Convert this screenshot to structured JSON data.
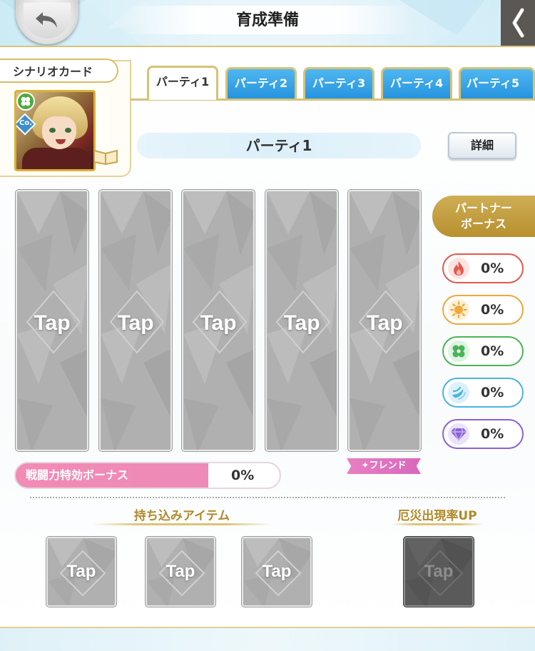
{
  "header": {
    "title": "育成準備"
  },
  "scenario": {
    "label": "シナリオカード",
    "card_attribute": "Co."
  },
  "tabs": [
    {
      "label": "パーティ1",
      "active": true
    },
    {
      "label": "パーティ2",
      "active": false
    },
    {
      "label": "パーティ3",
      "active": false
    },
    {
      "label": "パーティ4",
      "active": false
    },
    {
      "label": "パーティ5",
      "active": false
    }
  ],
  "party": {
    "name": "パーティ1",
    "detail_button": "詳細"
  },
  "slots": {
    "tap_label": "Tap",
    "friend_tag": "✦フレンド"
  },
  "partner": {
    "title_line1": "パートナー",
    "title_line2": "ボーナス",
    "bonuses": [
      {
        "icon": "fire-icon",
        "value": "0%",
        "color": "#e05a4f"
      },
      {
        "icon": "sun-icon",
        "value": "0%",
        "color": "#f0a83a"
      },
      {
        "icon": "clover-icon",
        "value": "0%",
        "color": "#4bb35a"
      },
      {
        "icon": "wind-icon",
        "value": "0%",
        "color": "#4bb3e0"
      },
      {
        "icon": "diamond-icon",
        "value": "0%",
        "color": "#8a62d8"
      }
    ]
  },
  "combat": {
    "label": "戦闘力特効ボーナス",
    "value": "0%"
  },
  "items": {
    "title": "持ち込みアイテム",
    "tap_label": "Tap"
  },
  "calamity": {
    "title": "厄災出現率UP",
    "tap_label": "Tap"
  },
  "colors": {
    "accent_gold": "#d6c278",
    "tab_blue": "#2594df",
    "pink": "#ec8ab8"
  }
}
